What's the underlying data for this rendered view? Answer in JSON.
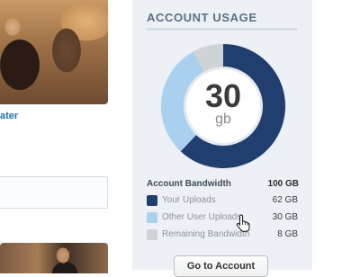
{
  "left": {
    "link_fragment": "ater"
  },
  "usage_panel": {
    "title": "ACCOUNT USAGE",
    "center_value": "30",
    "center_unit": "gb",
    "bandwidth_label": "Account Bandwidth",
    "bandwidth_total": "100 GB",
    "legend": [
      {
        "name": "Your Uploads",
        "value": "62 GB",
        "gb": 62,
        "color": "#203e6e"
      },
      {
        "name": "Other User Uploads",
        "value": "30 GB",
        "gb": 30,
        "color": "#a9d1ef"
      },
      {
        "name": "Remaining Bandwidth",
        "value": "8 GB",
        "gb": 8,
        "color": "#cfd3d6"
      }
    ],
    "button_label": "Go to Account"
  }
}
